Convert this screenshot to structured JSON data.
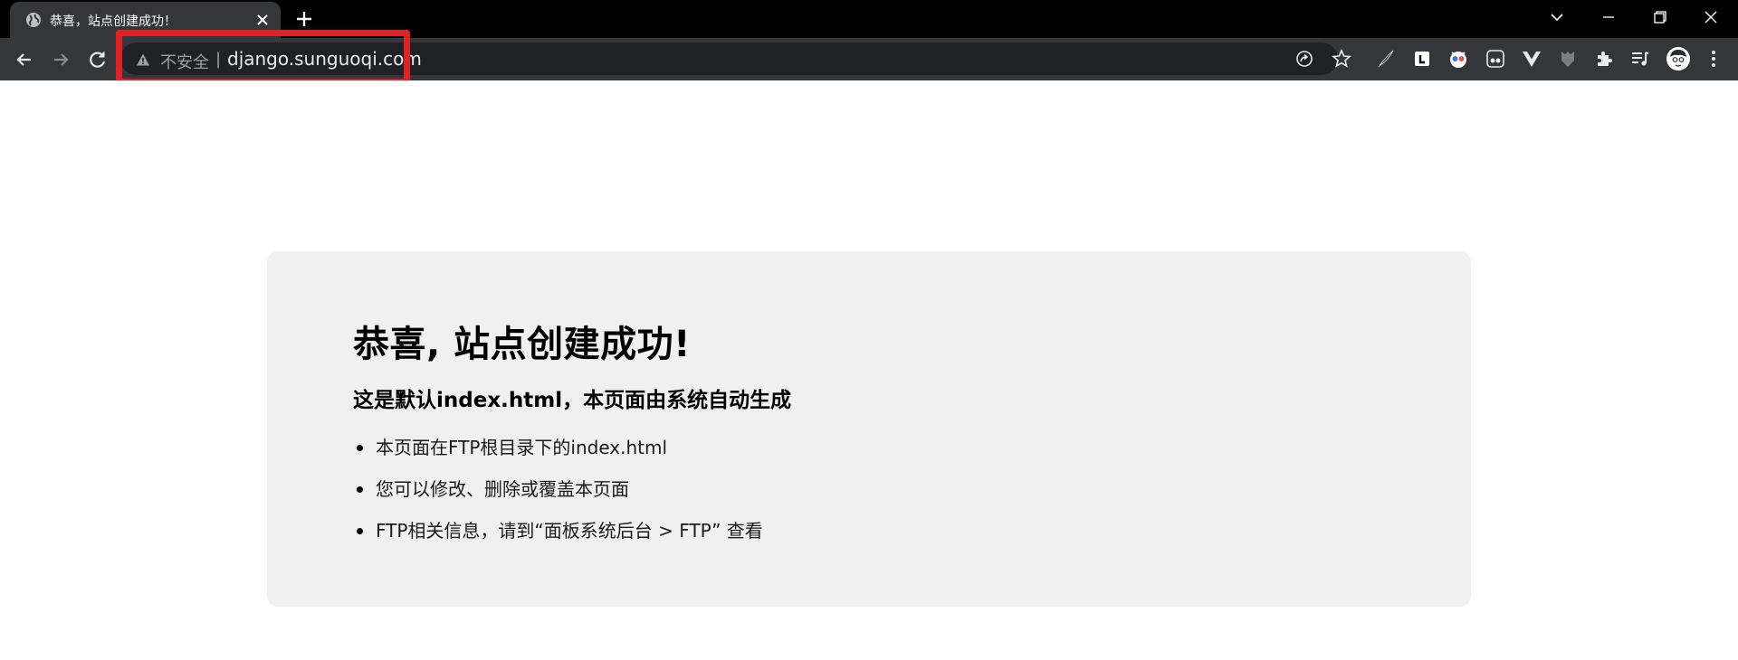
{
  "tab": {
    "title": "恭喜，站点创建成功！"
  },
  "address_bar": {
    "security_label": "不安全",
    "separator": "|",
    "url": "django.sunguoqi.com"
  },
  "page": {
    "heading": "恭喜, 站点创建成功!",
    "subheading": "这是默认index.html，本页面由系统自动生成",
    "items": [
      "本页面在FTP根目录下的index.html",
      "您可以修改、删除或覆盖本页面",
      "FTP相关信息，请到“面板系统后台 > FTP” 查看"
    ]
  },
  "colors": {
    "tab_bg": "#35363a",
    "titlebar_bg": "#000000",
    "omnibox_bg": "#202124",
    "highlight": "#e02226",
    "card_bg": "#f0f0f0"
  }
}
